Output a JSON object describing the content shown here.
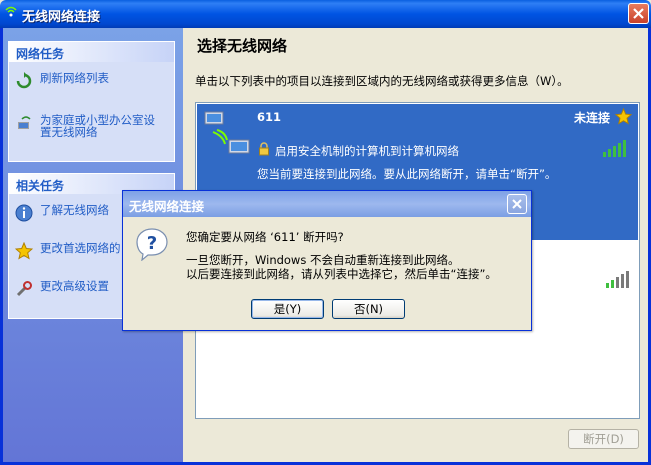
{
  "window": {
    "title": "无线网络连接"
  },
  "sidebar": {
    "network_tasks": {
      "header": "网络任务",
      "items": [
        {
          "label": "刷新网络列表",
          "icon": "refresh-icon"
        },
        {
          "label_line1": "为家庭或小型办公室设",
          "label_line2": "置无线网络",
          "icon": "wireless-setup-icon"
        }
      ]
    },
    "related_tasks": {
      "header": "相关任务",
      "items": [
        {
          "label": "了解无线网络",
          "icon": "info-icon"
        },
        {
          "label": "更改首选网络的",
          "icon": "star-icon"
        },
        {
          "label": "更改高级设置",
          "icon": "settings-icon"
        }
      ]
    }
  },
  "main": {
    "title": "选择无线网络",
    "instruction": "单击以下列表中的项目以连接到区域内的无线网络或获得更多信息（W）。",
    "networks": [
      {
        "name": "611",
        "status": "未连接",
        "security": "启用安全机制的计算机到计算机网络",
        "note": "您当前要连接到此网络。要从此网络断开，请单击“断开”。",
        "signal_bars": 5
      }
    ],
    "disconnect_button": "断开(D)"
  },
  "dialog": {
    "title": "无线网络连接",
    "question": "您确定要从网络 ‘611’ 断开吗?",
    "body_line1": "一旦您断开，Windows 不会自动重新连接到此网络。",
    "body_line2": "以后要连接到此网络，请从列表中选择它，然后单击“连接”。",
    "yes_button": "是(Y)",
    "no_button": "否(N)"
  },
  "colors": {
    "titlebar": "#0054E3",
    "selected_row": "#316AC5",
    "link": "#215DC6",
    "sidebar": "#7BA2E7"
  }
}
